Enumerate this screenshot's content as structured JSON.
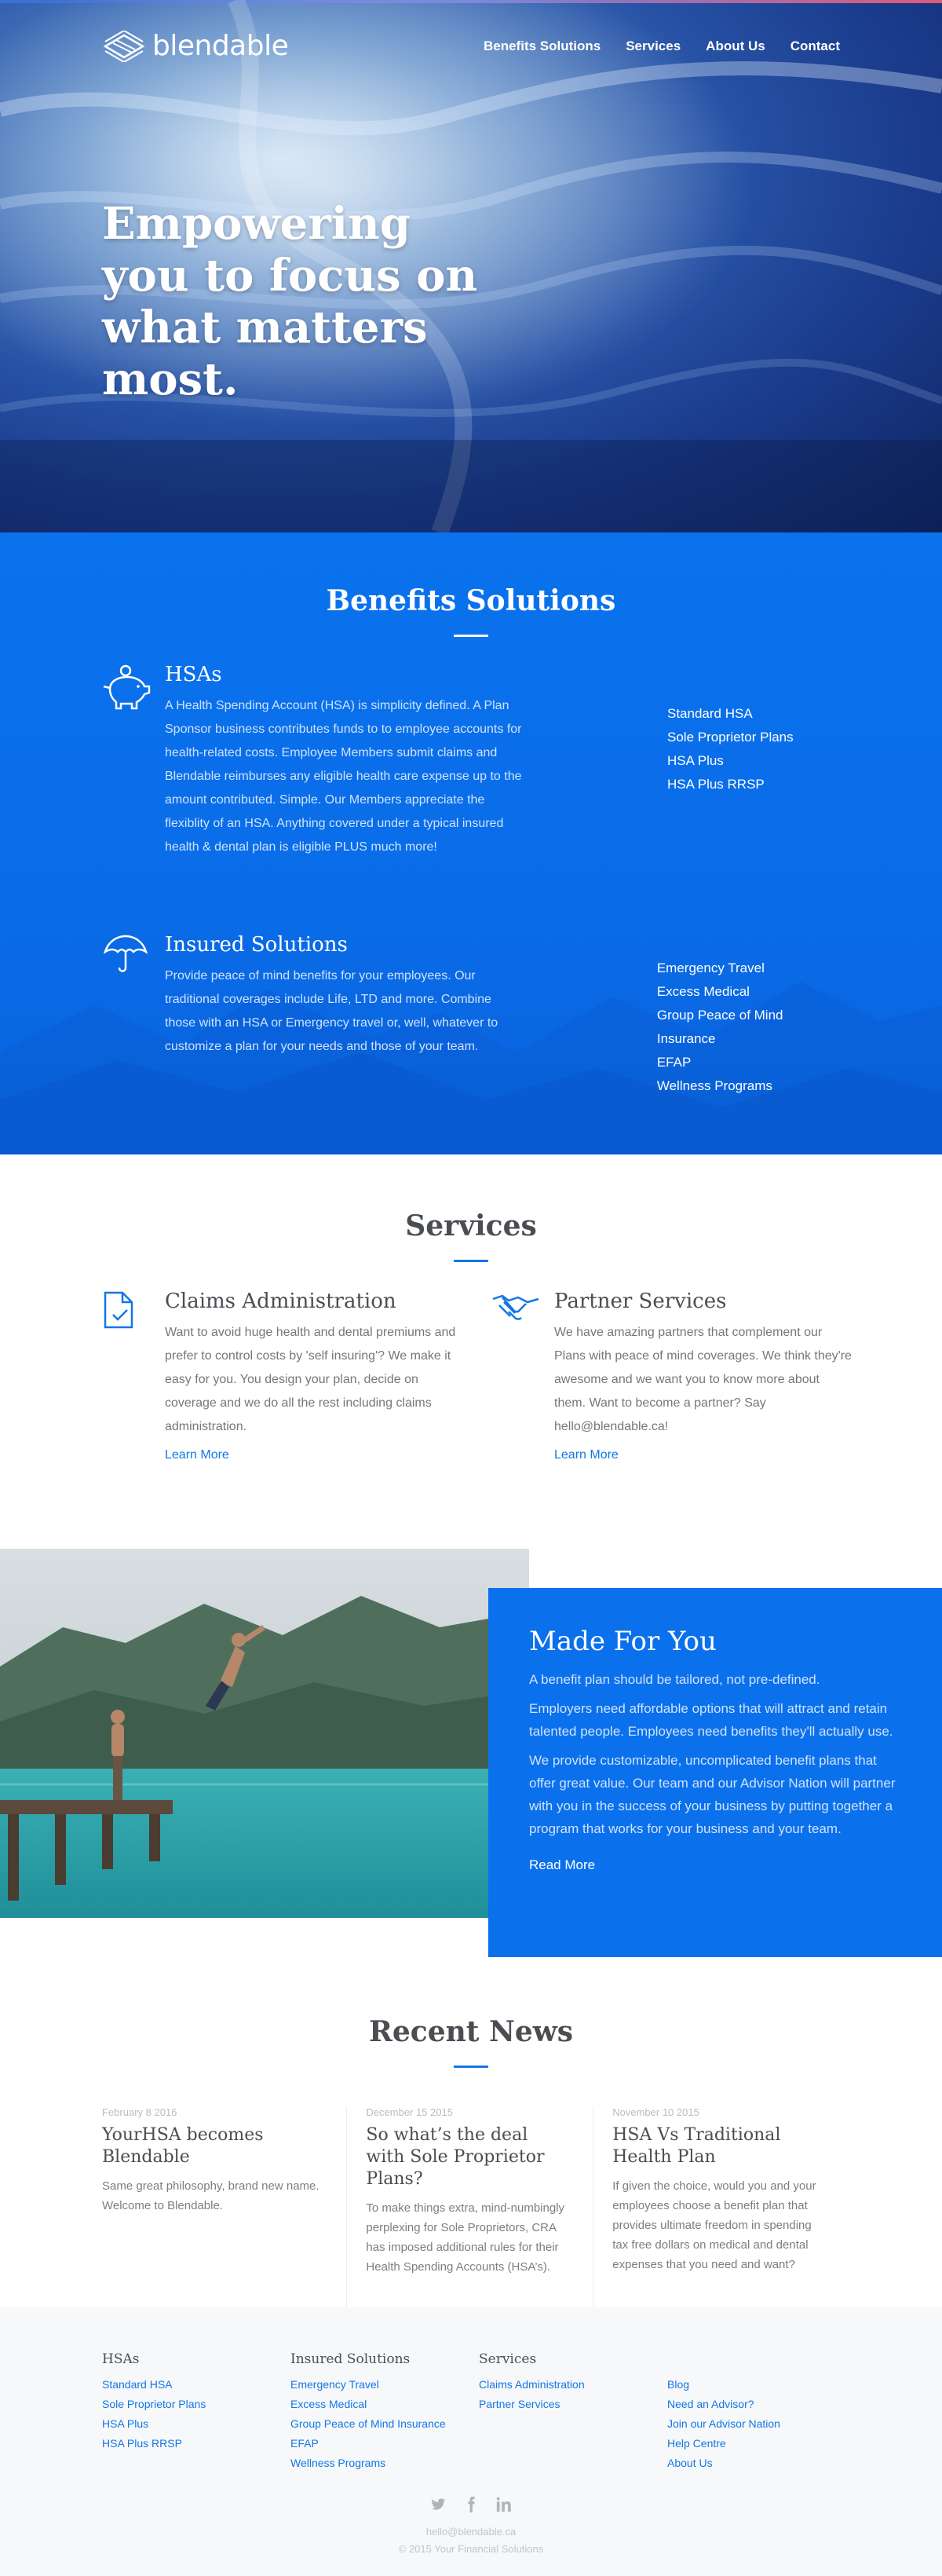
{
  "brand": {
    "name": "blendable"
  },
  "nav": {
    "items": [
      "Benefits Solutions",
      "Services",
      "About Us",
      "Contact"
    ]
  },
  "hero": {
    "headline": "Empowering you to focus on what matters most."
  },
  "benefits": {
    "title": "Benefits Solutions",
    "hsa": {
      "title": "HSAs",
      "text": "A Health Spending Account (HSA) is simplicity defined. A Plan Sponsor business contributes funds to to employee accounts for health-related costs. Employee Members submit claims and Blendable reimburses any eligible health care expense up to the amount contributed. Simple. Our Members appreciate the flexiblity of an HSA. Anything covered under a typical insured health & dental plan is eligible PLUS much more!",
      "links": [
        "Standard HSA",
        "Sole Proprietor Plans",
        "HSA Plus",
        "HSA Plus RRSP"
      ]
    },
    "insured": {
      "title": "Insured Solutions",
      "text": "Provide peace of mind benefits for your employees. Our traditional coverages include Life, LTD and more. Combine those with an HSA or Emergency travel or, well, whatever to customize a plan for your needs and those of your team.",
      "links": [
        "Emergency Travel",
        "Excess Medical",
        "Group Peace of Mind Insurance",
        "EFAP",
        "Wellness Programs"
      ]
    }
  },
  "services": {
    "title": "Services",
    "claims": {
      "title": "Claims Administration",
      "text": "Want to avoid huge health and dental premiums and prefer to control costs by 'self insuring'? We make it easy for you. You design your plan, decide on coverage and we do all the rest including claims administration.",
      "link": "Learn More"
    },
    "partner": {
      "title": "Partner Services",
      "text": "We have amazing partners that complement our Plans with peace of mind coverages. We think they're awesome and we want you to know more about them. Want to become a partner? Say hello@blendable.ca!",
      "link": "Learn More"
    }
  },
  "made": {
    "title": "Made For You",
    "p1": "A benefit plan should be tailored, not pre-defined.",
    "p2": "Employers need affordable options that will attract and retain talented people. Employees need benefits they'll actually use.",
    "p3": "We provide customizable, uncomplicated benefit plans that offer great value. Our team and our Advisor Nation will partner with you in the success of your business by putting together a program that works for your business and your team.",
    "link": "Read More"
  },
  "news": {
    "title": "Recent News",
    "items": [
      {
        "date": "February 8 2016",
        "title": "YourHSA becomes Blendable",
        "text": "Same great philosophy, brand new name. Welcome to Blendable."
      },
      {
        "date": "December 15 2015",
        "title": "So what’s the deal with Sole Proprietor Plans?",
        "text": "To make things extra, mind-numbingly perplexing for Sole Proprietors, CRA has imposed additional rules for their Health Spending Accounts (HSA’s)."
      },
      {
        "date": "November 10 2015",
        "title": "HSA Vs Traditional Health Plan",
        "text": "If given the choice, would you and your employees choose a benefit plan that provides ultimate freedom in spending tax free dollars on medical and dental expenses that you need and want?"
      }
    ]
  },
  "footer": {
    "cols": [
      {
        "title": "HSAs",
        "links": [
          "Standard HSA",
          "Sole Proprietor Plans",
          "HSA Plus",
          "HSA Plus RRSP"
        ]
      },
      {
        "title": "Insured Solutions",
        "links": [
          "Emergency Travel",
          "Excess Medical",
          "Group Peace of Mind Insurance",
          "EFAP",
          "Wellness Programs"
        ]
      },
      {
        "title": "Services",
        "links": [
          "Claims Administration",
          "Partner Services"
        ]
      },
      {
        "title": "",
        "links": [
          "Blog",
          "Need an Advisor?",
          "Join our Advisor Nation",
          "Help Centre",
          "About Us"
        ]
      }
    ],
    "social": [
      "twitter-icon",
      "facebook-icon",
      "linkedin-icon"
    ],
    "email": "hello@blendable.ca",
    "copyright": "© 2015 Your Financial Solutions"
  },
  "colors": {
    "primary": "#0b70ec",
    "link": "#1277e6",
    "heading": "#4a4d52"
  }
}
